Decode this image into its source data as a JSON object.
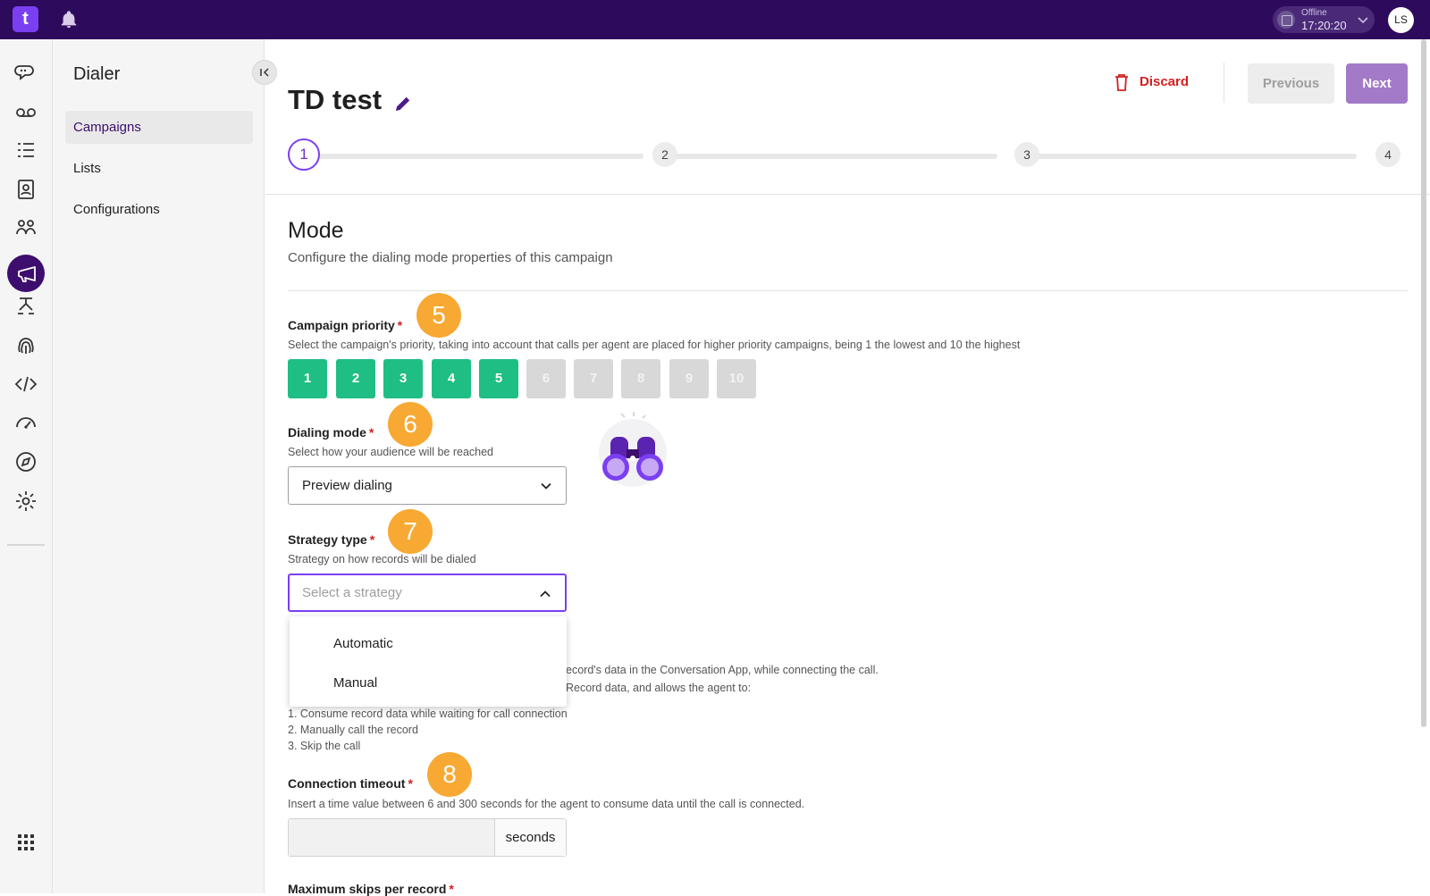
{
  "topbar": {
    "logo_letter": "t",
    "status_label": "Offline",
    "status_time": "17:20:20",
    "avatar_initials": "LS"
  },
  "sidebar": {
    "title": "Dialer",
    "items": [
      {
        "label": "Campaigns",
        "active": true
      },
      {
        "label": "Lists",
        "active": false
      },
      {
        "label": "Configurations",
        "active": false
      }
    ]
  },
  "header": {
    "title": "TD test",
    "discard_label": "Discard",
    "previous_label": "Previous",
    "next_label": "Next",
    "steps": [
      "1",
      "2",
      "3",
      "4"
    ],
    "current_step": 1
  },
  "mode": {
    "title": "Mode",
    "description": "Configure the dialing mode properties of this campaign"
  },
  "campaign_priority": {
    "label": "Campaign priority",
    "required": "*",
    "badge": "5",
    "help": "Select the campaign's priority, taking into account that calls per agent are placed for higher priority campaigns, being 1 the lowest and 10 the highest",
    "options": [
      "1",
      "2",
      "3",
      "4",
      "5",
      "6",
      "7",
      "8",
      "9",
      "10"
    ],
    "selected": 5
  },
  "dialing_mode": {
    "label": "Dialing mode",
    "required": "*",
    "badge": "6",
    "help": "Select how your audience will be reached",
    "value": "Preview dialing"
  },
  "strategy_type": {
    "label": "Strategy type",
    "required": "*",
    "badge": "7",
    "help": "Strategy on how records will be dialed",
    "placeholder": "Select a strategy",
    "options": [
      "Automatic",
      "Manual"
    ]
  },
  "preview_info": {
    "line1_tail": "ecord's data in the Conversation App, while connecting the call.",
    "line2_tail": "Record data, and allows the agent to:",
    "list": [
      "1. Consume record data while waiting for call connection",
      "2. Manually call the record",
      "3. Skip the call"
    ]
  },
  "connection_timeout": {
    "label": "Connection timeout",
    "required": "*",
    "badge": "8",
    "help": "Insert a time value between 6 and 300 seconds for the agent to consume data until the call is connected.",
    "value": "",
    "suffix": "seconds"
  },
  "max_skips": {
    "label": "Maximum skips per record",
    "required": "*"
  },
  "colors": {
    "topbar": "#2e0a5c",
    "accent": "#7b3ff2",
    "priority_on": "#1fbe84",
    "badge": "#f7a933",
    "danger": "#d42020"
  }
}
